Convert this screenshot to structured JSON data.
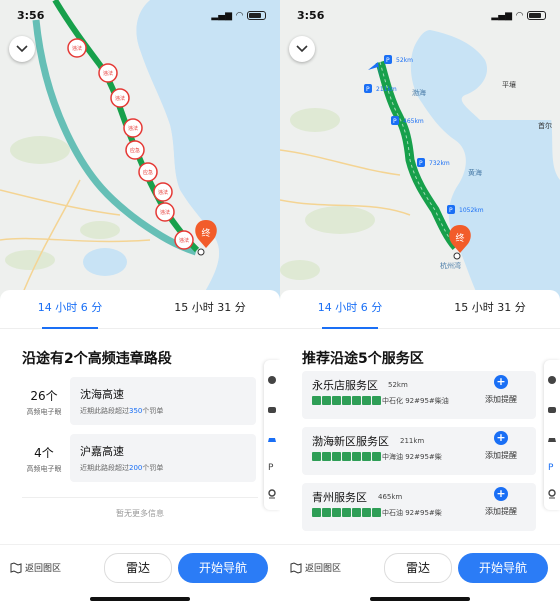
{
  "status": {
    "time": "3:56"
  },
  "colors": {
    "accent": "#1a6ff5",
    "route": "#17a04b",
    "road": "#4db6ac",
    "violation": "#e53935",
    "service": "#1a6ff5",
    "destination": "#f25c2a"
  },
  "screen1": {
    "map": {
      "violation_markers": [
        "违法",
        "违法",
        "违法",
        "违法",
        "应急",
        "应急",
        "违法",
        "违法",
        "违法"
      ],
      "destination_label": "终"
    },
    "tabs": [
      {
        "label": "14 小时 6 分",
        "active": true
      },
      {
        "label": "15 小时 31 分",
        "active": false
      }
    ],
    "heading": "沿途有2个高频违章路段",
    "segments": [
      {
        "count": "26个",
        "count_label": "高频电子眼",
        "road": "沈海高速",
        "desc_prefix": "近期此路段超过",
        "desc_highlight": "350",
        "desc_suffix": "个罚单"
      },
      {
        "count": "4个",
        "count_label": "高频电子眼",
        "road": "沪嘉高速",
        "desc_prefix": "近期此路段超过",
        "desc_highlight": "200",
        "desc_suffix": "个罚单"
      }
    ],
    "more": "暂无更多信息",
    "bottom": {
      "back": "返回图区",
      "radar": "雷达",
      "start": "开始导航"
    }
  },
  "screen2": {
    "map": {
      "service_markers": [
        "52km",
        "211km",
        "465km",
        "732km",
        "1052km"
      ],
      "place_labels": [
        "渤海",
        "黄海",
        "杭州湾",
        "平壤",
        "首尔"
      ],
      "destination_label": "终"
    },
    "tabs": [
      {
        "label": "14 小时 6 分",
        "active": true
      },
      {
        "label": "15 小时 31 分",
        "active": false
      }
    ],
    "heading": "推荐沿途5个服务区",
    "services": [
      {
        "name": "永乐店服务区",
        "dist": "52km",
        "fuel": "中石化 92#95#柴油",
        "add": "添加提醒"
      },
      {
        "name": "渤海新区服务区",
        "dist": "211km",
        "fuel": "中海油 92#95#柴",
        "add": "添加提醒"
      },
      {
        "name": "青州服务区",
        "dist": "465km",
        "fuel": "中石油 92#95#柴",
        "add": "添加提醒"
      }
    ],
    "bottom": {
      "back": "返回图区",
      "radar": "雷达",
      "start": "开始导航"
    }
  }
}
